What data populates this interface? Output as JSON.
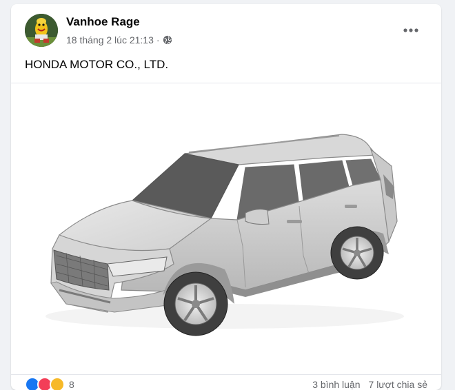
{
  "post": {
    "author": "Vanhoe Rage",
    "timestamp": "18 tháng 2 lúc 21:13",
    "separator": "·",
    "privacy_icon": "globe-icon",
    "text": "HONDA MOTOR CO., LTD.",
    "more_icon": "more-options-icon",
    "image_icon": "car-patent-drawing"
  },
  "reactions": {
    "icons": [
      "like-icon",
      "love-icon",
      "haha-icon"
    ],
    "count": "8",
    "comments": "3 bình luận",
    "shares": "7 lượt chia sẻ"
  },
  "colors": {
    "like": "#1877f2",
    "love": "#f33e58",
    "haha": "#f7b928",
    "secondary_text": "#65676b"
  }
}
